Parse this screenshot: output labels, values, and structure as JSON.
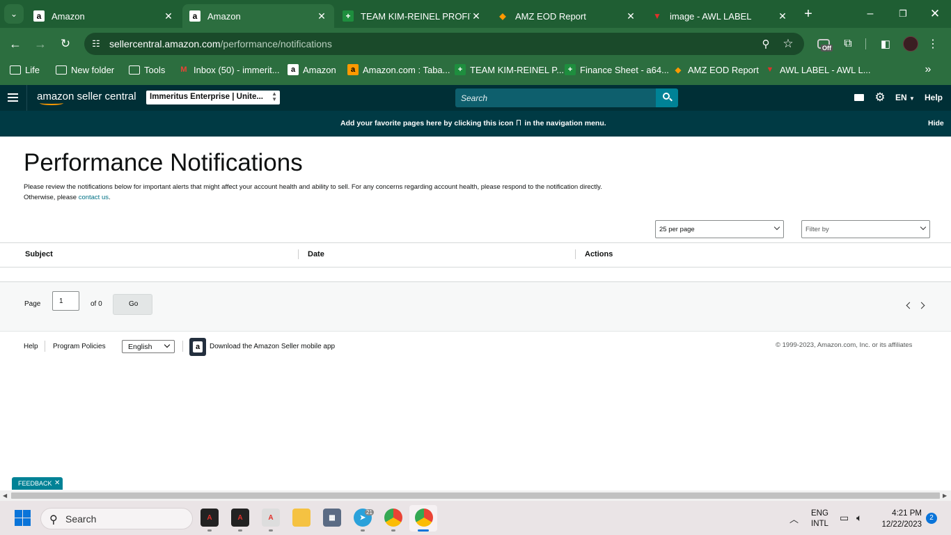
{
  "browser": {
    "tabs": [
      {
        "title": "Amazon",
        "icon": "amazon-icon",
        "active": false
      },
      {
        "title": "Amazon",
        "icon": "amazon-icon",
        "active": true
      },
      {
        "title": "TEAM KIM-REINEL PROFIT S",
        "icon": "sheets-icon",
        "active": false
      },
      {
        "title": "AMZ EOD Report",
        "icon": "eod-report-icon",
        "active": false
      },
      {
        "title": "image - AWL LABEL",
        "icon": "awl-label-icon",
        "active": false
      }
    ],
    "url_domain": "sellercentral.amazon.com",
    "url_path": "/performance/notifications",
    "extension_badge": "Off",
    "bookmarks": [
      {
        "label": "Life",
        "icon": "folder-icon"
      },
      {
        "label": "New folder",
        "icon": "folder-icon"
      },
      {
        "label": "Tools",
        "icon": "folder-icon"
      },
      {
        "label": "Inbox (50) - immerit...",
        "icon": "gmail-icon"
      },
      {
        "label": "Amazon",
        "icon": "amazon-icon"
      },
      {
        "label": "Amazon.com : Taba...",
        "icon": "amazon-icon"
      },
      {
        "label": "TEAM KIM-REINEL P...",
        "icon": "sheets-icon"
      },
      {
        "label": "Finance Sheet - a64...",
        "icon": "sheets-icon"
      },
      {
        "label": "AMZ EOD Report",
        "icon": "eod-report-icon"
      },
      {
        "label": "AWL LABEL - AWL L...",
        "icon": "awl-label-icon"
      }
    ]
  },
  "seller_central": {
    "logo": "amazon seller central",
    "account_selector": "Immeritus Enterprise | Unite...",
    "search_placeholder": "Search",
    "language": "EN",
    "help": "Help",
    "banner_text_before": "Add your favorite pages here by clicking this icon",
    "banner_text_after": "in the navigation menu.",
    "banner_hide": "Hide"
  },
  "page": {
    "title": "Performance Notifications",
    "description": "Please review the notifications below for important alerts that might affect your account health and ability to sell. For any concerns regarding account health, please respond to the notification directly. Otherwise, please",
    "contact_link": "contact us",
    "per_page": "25 per page",
    "filter_placeholder": "Filter by",
    "table_headers": [
      "Subject",
      "Date",
      "Actions"
    ],
    "pagination": {
      "page_label": "Page",
      "page_value": "1",
      "of_label": "of 0",
      "go_label": "Go"
    }
  },
  "footer": {
    "help": "Help",
    "program_policies": "Program Policies",
    "language": "English",
    "download_app": "Download the Amazon Seller mobile app",
    "copyright": "© 1999-2023, Amazon.com, Inc. or its affiliates"
  },
  "feedback": "FEEDBACK",
  "taskbar": {
    "search_placeholder": "Search",
    "lang_line1": "ENG",
    "lang_line2": "INTL",
    "time": "4:21 PM",
    "date": "12/22/2023",
    "notification_count": "2",
    "telegram_badge": "21"
  },
  "colors": {
    "chrome_dark": "#1f5e33",
    "chrome_toolbar": "#2c6e3f",
    "sc_header": "#002f36",
    "sc_banner": "#003a44",
    "search_bg": "#0e5f6d",
    "search_btn": "#008296",
    "link": "#007185"
  }
}
